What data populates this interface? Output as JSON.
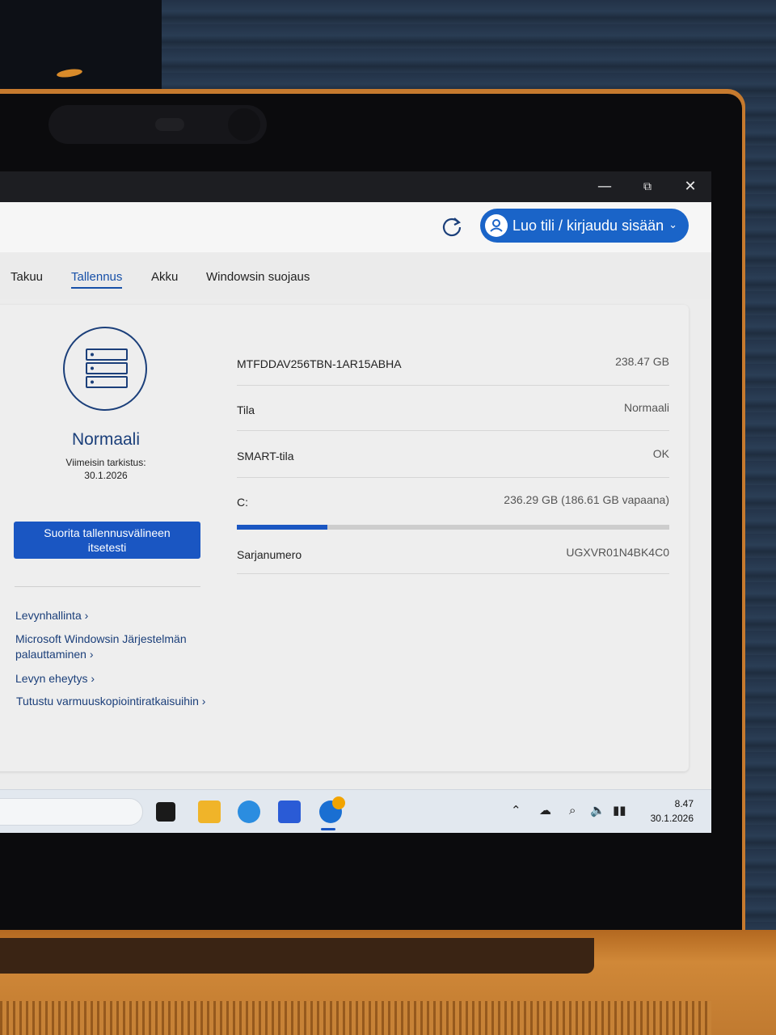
{
  "header": {
    "account_button": "Luo tili / kirjaudu sisään"
  },
  "tabs": [
    {
      "label": "Takuu",
      "active": false
    },
    {
      "label": "Tallennus",
      "active": true
    },
    {
      "label": "Akku",
      "active": false
    },
    {
      "label": "Windowsin suojaus",
      "active": false
    }
  ],
  "status": {
    "title": "Normaali",
    "last_check_label": "Viimeisin tarkistus:",
    "last_check_date": "30.1.2026",
    "selftest_button_line1": "Suorita tallennusvälineen",
    "selftest_button_line2": "itsetesti"
  },
  "links": {
    "disk_management": "Levynhallinta ›",
    "system_restore_line1": "Microsoft Windowsin Järjestelmän",
    "system_restore_line2": "palauttaminen ›",
    "disk_health": "Levyn eheytys ›",
    "backup": "Tutustu varmuuskopiointiratkaisuihin ›"
  },
  "details": {
    "model": "MTFDDAV256TBN-1AR15ABHA",
    "capacity": "238.47 GB",
    "state_label": "Tila",
    "state_value": "Normaali",
    "smart_label": "SMART-tila",
    "smart_value": "OK",
    "drive_label": "C:",
    "drive_value": "236.29 GB (186.61 GB vapaana)",
    "drive_used_fraction": 0.21,
    "serial_label": "Sarjanumero",
    "serial_value": "UGXVR01N4BK4C0"
  },
  "taskbar": {
    "time": "8.47",
    "date": "30.1.2026"
  },
  "colors": {
    "accent": "#1a56c2",
    "account_button": "#1a64c8",
    "status_text": "#1b3f7a"
  }
}
